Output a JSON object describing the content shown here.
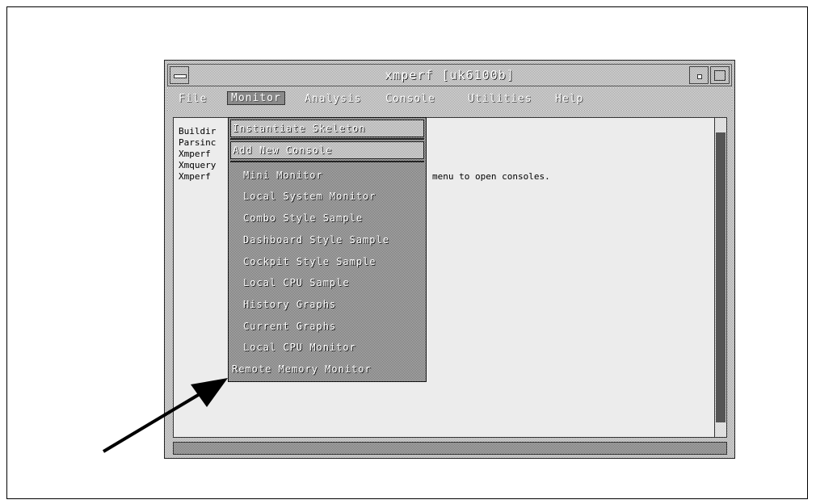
{
  "window": {
    "title": "xmperf [uk6100b]"
  },
  "menubar": {
    "items": [
      "File",
      "Monitor",
      "Analysis",
      "Console",
      "Utilities",
      "Help"
    ]
  },
  "log": {
    "lines": [
      "Buildir",
      "Parsinc",
      "Xmperf",
      "Xmquery",
      "Xmperf"
    ],
    "tail": "menu to open consoles."
  },
  "dropdown": {
    "top_items": [
      "Instantiate Skeleton",
      "Add New Console"
    ],
    "items": [
      "Mini Monitor",
      "Local System Monitor",
      "Combo Style Sample",
      "Dashboard Style Sample",
      "Cockpit Style Sample",
      "Local CPU Sample",
      "History Graphs",
      "Current Graphs",
      "Local CPU Monitor",
      "Remote Memory Monitor"
    ]
  }
}
